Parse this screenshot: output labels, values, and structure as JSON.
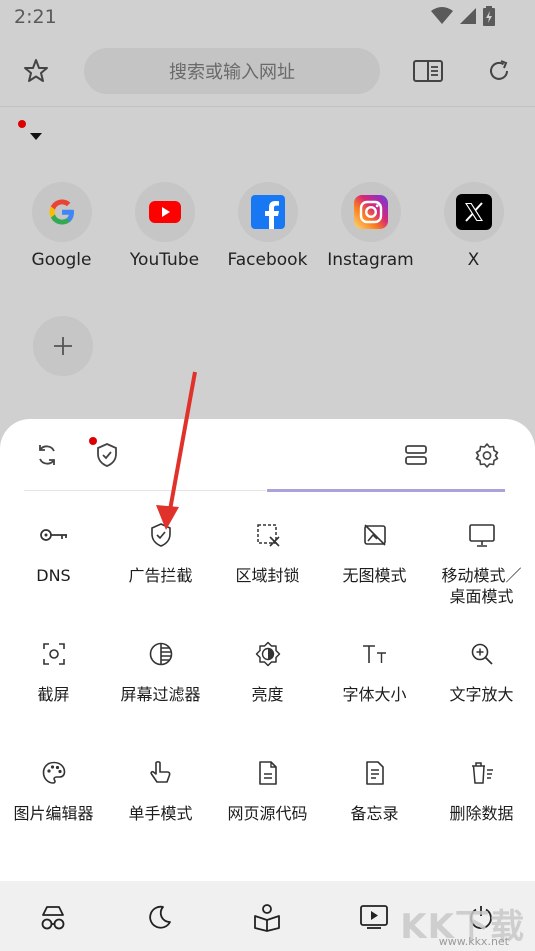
{
  "status_bar": {
    "time": "2:21"
  },
  "top_bar": {
    "search_placeholder": "搜索或输入网址"
  },
  "shortcuts": [
    {
      "label": "Google",
      "icon": "google-icon"
    },
    {
      "label": "YouTube",
      "icon": "youtube-icon"
    },
    {
      "label": "Facebook",
      "icon": "facebook-icon"
    },
    {
      "label": "Instagram",
      "icon": "instagram-icon"
    },
    {
      "label": "X",
      "icon": "x-icon"
    }
  ],
  "menu": {
    "rows": [
      [
        {
          "label": "DNS",
          "icon": "key-icon"
        },
        {
          "label": "广告拦截",
          "icon": "shield-check-icon"
        },
        {
          "label": "区域封锁",
          "icon": "area-block-icon"
        },
        {
          "label": "无图模式",
          "icon": "no-image-icon"
        },
        {
          "label": "移动模式／\n桌面模式",
          "icon": "monitor-icon"
        }
      ],
      [
        {
          "label": "截屏",
          "icon": "screenshot-icon"
        },
        {
          "label": "屏幕过滤器",
          "icon": "screen-filter-icon"
        },
        {
          "label": "亮度",
          "icon": "brightness-icon"
        },
        {
          "label": "字体大小",
          "icon": "font-size-icon"
        },
        {
          "label": "文字放大",
          "icon": "zoom-in-icon"
        }
      ],
      [
        {
          "label": "图片编辑器",
          "icon": "palette-icon"
        },
        {
          "label": "单手模式",
          "icon": "hand-pointer-icon"
        },
        {
          "label": "网页源代码",
          "icon": "source-code-icon"
        },
        {
          "label": "备忘录",
          "icon": "memo-icon"
        },
        {
          "label": "删除数据",
          "icon": "trash-icon"
        }
      ]
    ]
  },
  "watermark": {
    "text": "KK下载",
    "url": "www.kkx.net"
  },
  "colors": {
    "accent": "#a9a3dc",
    "dot": "#dd0000",
    "arrow": "#e0322b"
  }
}
